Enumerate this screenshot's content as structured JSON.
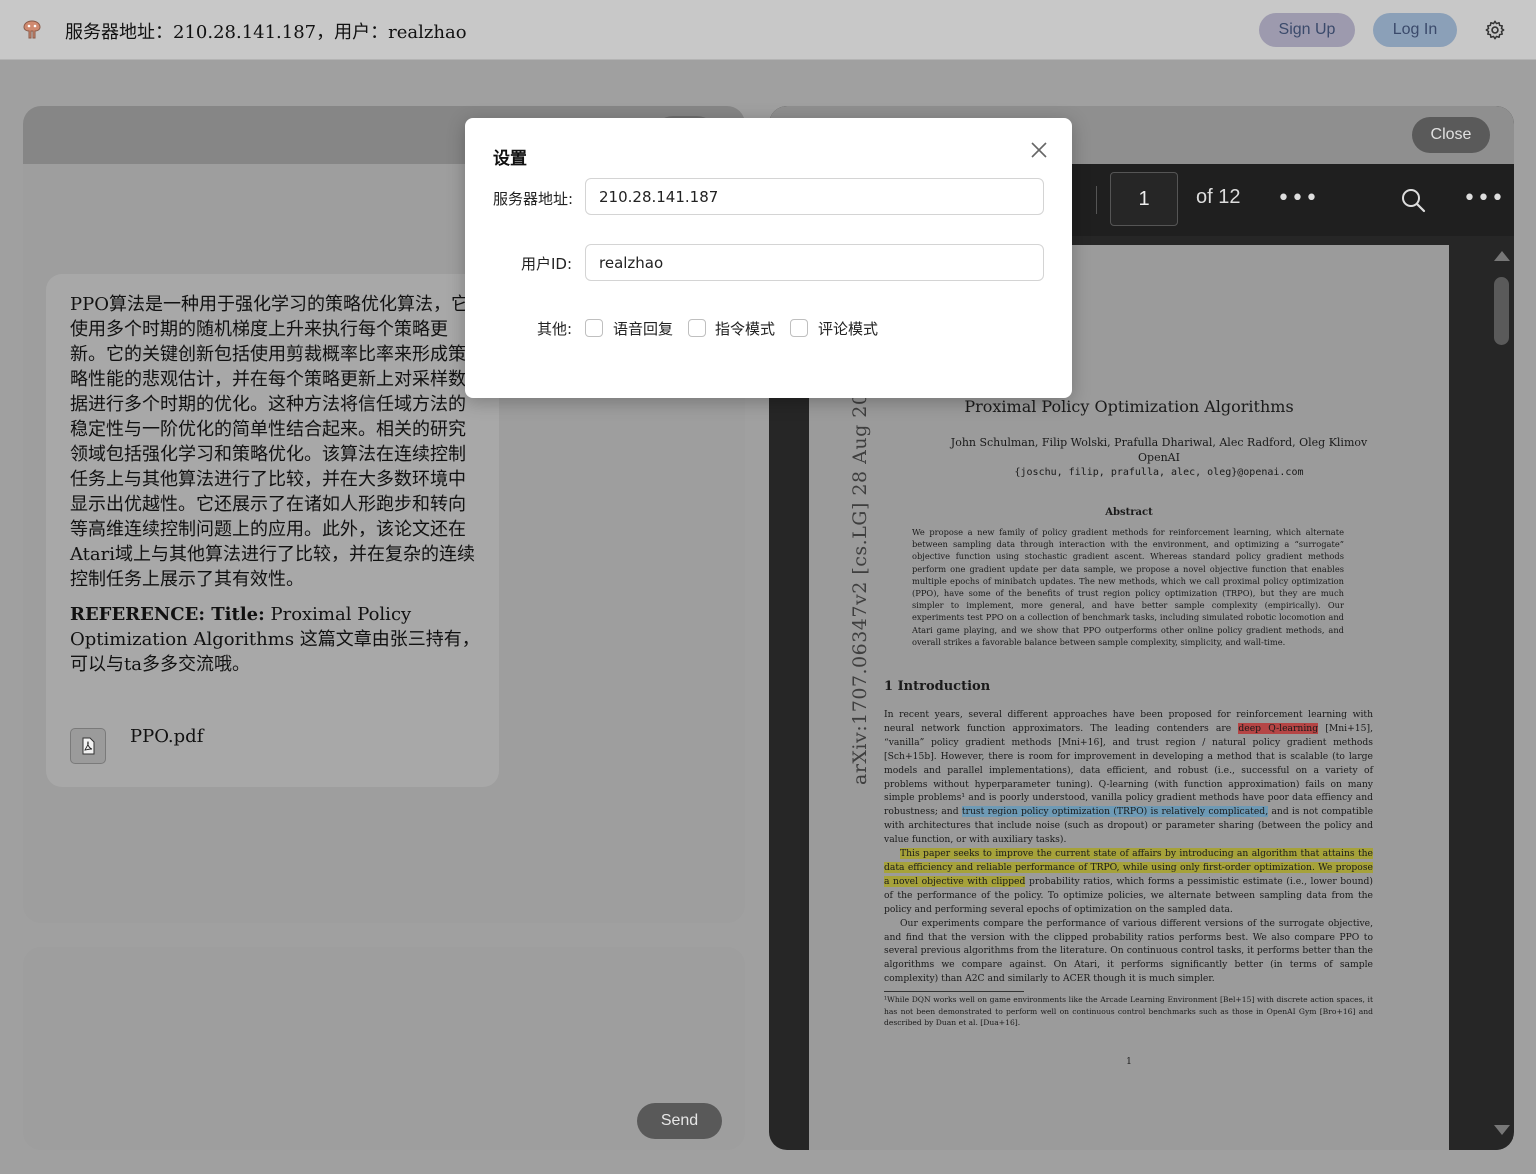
{
  "header": {
    "server_info": "服务器地址：210.28.141.187，用户：realzhao",
    "signup_label": "Sign Up",
    "login_label": "Log In",
    "settings_icon": "gear-icon",
    "logo_icon": "app-logo-icon"
  },
  "chat": {
    "message_body": "PPO算法是一种用于强化学习的策略优化算法，它使用多个时期的随机梯度上升来执行每个策略更新。它的关键创新包括使用剪裁概率比率来形成策略性能的悲观估计，并在每个策略更新上对采样数据进行多个时期的优化。这种方法将信任域方法的稳定性与一阶优化的简单性结合起来。相关的研究领域包括强化学习和策略优化。该算法在连续控制任务上与其他算法进行了比较，并在大多数环境中显示出优越性。它还展示了在诸如人形跑步和转向等高维连续控制问题上的应用。此外，该论文还在Atari域上与其他算法进行了比较，并在复杂的连续控制任务上展示了其有效性。",
    "reference_label": "REFERENCE: Title:",
    "reference_text": " Proximal Policy Optimization Algorithms 这篇文章由张三持有，可以与ta多多交流哦。",
    "attachment_name": "PPO.pdf",
    "send_label": "Send"
  },
  "pdf_viewer": {
    "close_label": "Close",
    "page_current": "1",
    "page_total": "of 12",
    "more_dots": "•••",
    "paper": {
      "arxiv_id": "arXiv:1707.06347v2  [cs.LG]  28 Aug 2017",
      "title": "Proximal Policy Optimization Algorithms",
      "authors": "John Schulman, Filip Wolski, Prafulla Dhariwal, Alec Radford, Oleg Klimov",
      "affiliation": "OpenAI",
      "emails": "{joschu, filip, prafulla, alec, oleg}@openai.com",
      "abstract_title": "Abstract",
      "abstract": "We propose a new family of policy gradient methods for reinforcement learning, which alternate between sampling data through interaction with the environment, and optimizing a “surrogate” objective function using stochastic gradient ascent. Whereas standard policy gradient methods perform one gradient update per data sample, we propose a novel objective function that enables multiple epochs of minibatch updates. The new methods, which we call proximal policy optimization (PPO), have some of the benefits of trust region policy optimization (TRPO), but they are much simpler to implement, more general, and have better sample complexity (empirically). Our experiments test PPO on a collection of benchmark tasks, including simulated robotic locomotion and Atari game playing, and we show that PPO outperforms other online policy gradient methods, and overall strikes a favorable balance between sample complexity, simplicity, and wall-time.",
      "section_title": "1    Introduction",
      "intro_p1_a": "In recent years, several different approaches have been proposed for reinforcement learning with neural network function approximators. The leading contenders are ",
      "intro_hl_red": "deep Q-learning",
      "intro_p1_b": " [Mni+15], “vanilla” policy gradient methods [Mni+16], and trust region / natural policy gradient methods [Sch+15b]. However, there is room for improvement in developing a method that is scalable (to large models and parallel implementations), data efficient, and robust (i.e., successful on a variety of problems without hyperparameter tuning). Q-learning (with function approximation) fails on many simple problems¹ and is poorly understood, vanilla policy gradient methods have poor data effiency and robustness; and ",
      "intro_hl_blue": "trust region policy optimization (TRPO) is relatively complicated,",
      "intro_p1_c": " and is not compatible with architectures that include noise (such as dropout) or parameter sharing (between the policy and value function, or with auxiliary tasks).",
      "intro_hl_yellow": "This paper seeks to improve the current state of affairs by introducing an algorithm that attains the data efficiency and reliable performance of TRPO, while using only first-order optimization. We propose a novel objective with clipped",
      "intro_p2_b": " probability ratios, which forms a pessimistic estimate (i.e., lower bound) of the performance of the policy. To optimize policies, we alternate between sampling data from the policy and performing several epochs of optimization on the sampled data.",
      "intro_p3": "Our experiments compare the performance of various different versions of the surrogate objective, and find that the version with the clipped probability ratios performs best. We also compare PPO to several previous algorithms from the literature. On continuous control tasks, it performs better than the algorithms we compare against. On Atari, it performs significantly better (in terms of sample complexity) than A2C and similarly to ACER though it is much simpler.",
      "footnote": "¹While DQN works well on game environments like the Arcade Learning Environment [Bel+15] with discrete action spaces, it has not been demonstrated to perform well on continuous control benchmarks such as those in OpenAI Gym [Bro+16] and described by Duan et al. [Dua+16].",
      "page_number": "1"
    }
  },
  "settings_modal": {
    "title": "设置",
    "server_label": "服务器地址:",
    "server_value": "210.28.141.187",
    "user_label": "用户ID:",
    "user_value": "realzhao",
    "other_label": "其他:",
    "options": [
      "语音回复",
      "指令模式",
      "评论模式"
    ]
  }
}
